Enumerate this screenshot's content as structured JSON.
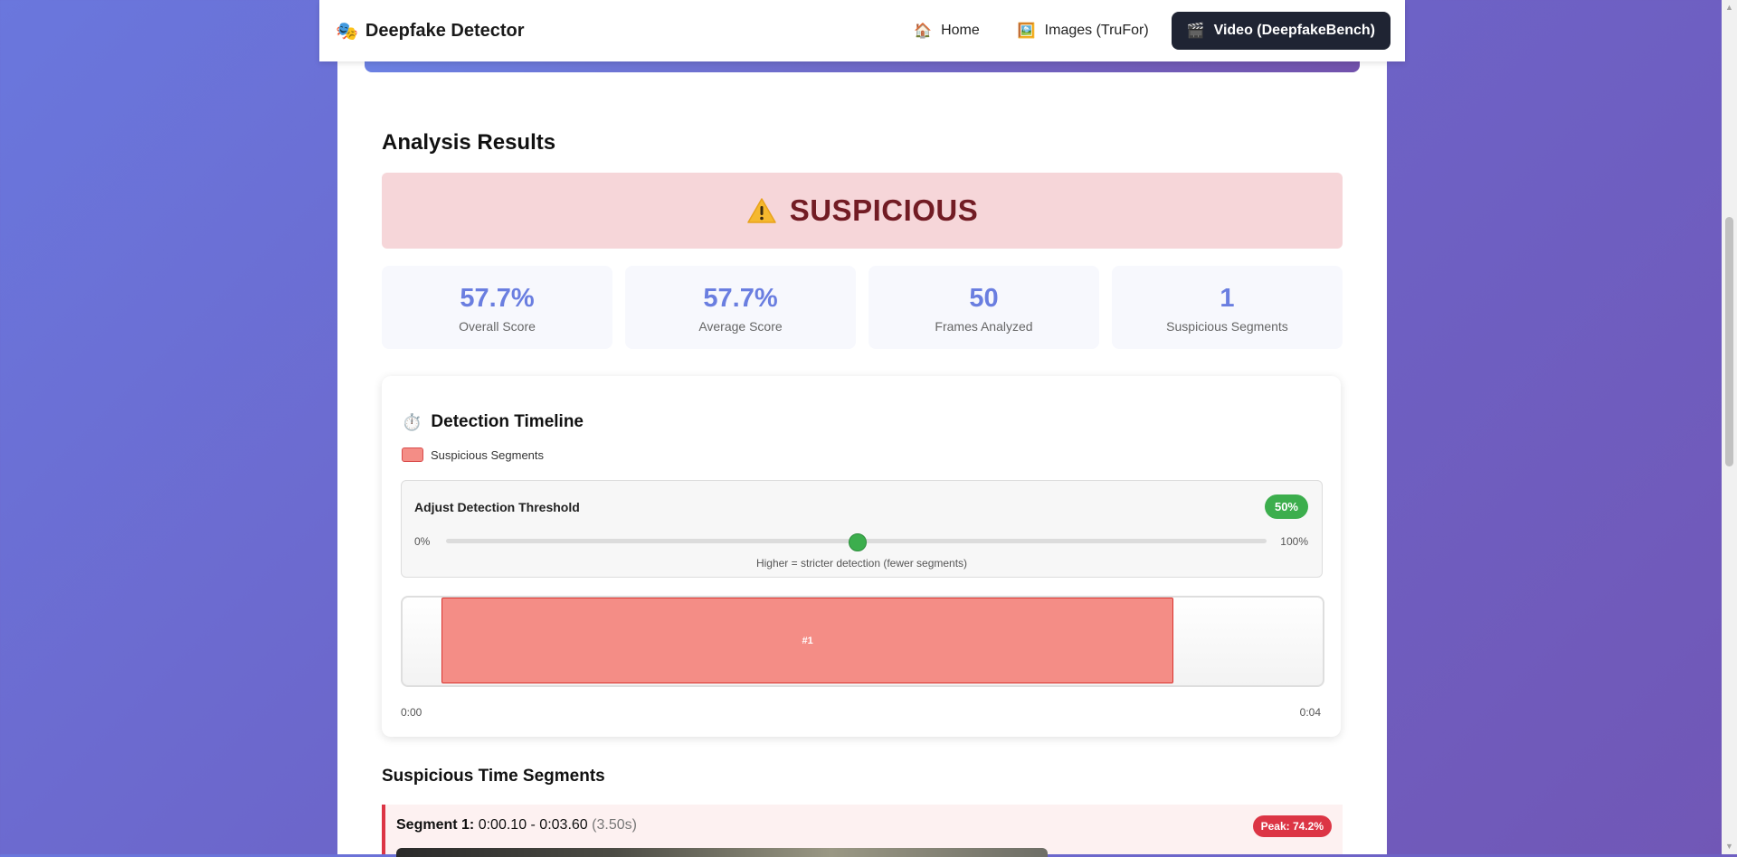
{
  "nav": {
    "brand": "Deepfake Detector",
    "brand_icon": "masks-icon",
    "links": [
      {
        "icon": "🏠",
        "label": "Home"
      },
      {
        "icon": "🖼️",
        "label": "Images (TruFor)"
      },
      {
        "icon": "🎬",
        "label": "Video (DeepfakeBench)"
      }
    ],
    "active_link": "Video (DeepfakeBench)"
  },
  "results": {
    "title": "Analysis Results",
    "verdict": "SUSPICIOUS",
    "verdict_icon": "warning-icon",
    "stats": [
      {
        "value": "57.7%",
        "label": "Overall Score"
      },
      {
        "value": "57.7%",
        "label": "Average Score"
      },
      {
        "value": "50",
        "label": "Frames Analyzed"
      },
      {
        "value": "1",
        "label": "Suspicious Segments"
      }
    ]
  },
  "timeline": {
    "title": "Detection Timeline",
    "icon": "⏱️",
    "legend": "Suspicious Segments",
    "threshold": {
      "label": "Adjust Detection Threshold",
      "value_label": "50%",
      "value": 0.5,
      "min_label": "0%",
      "max_label": "100%",
      "hint": "Higher = stricter detection (fewer segments)"
    },
    "duration_seconds": 4.3,
    "segments": [
      {
        "label": "#1",
        "start": 0.1,
        "end": 3.6
      }
    ],
    "start_label": "0:00",
    "end_label": "0:04"
  },
  "segments_section": {
    "title": "Suspicious Time Segments",
    "items": [
      {
        "name": "Segment 1:",
        "range": "0:00.10 - 0:03.60",
        "duration": "(3.50s)",
        "peak": "Peak: 74.2%"
      }
    ]
  },
  "colors": {
    "accent": "#6a7ee0",
    "danger": "#dc3545",
    "success": "#3cae4d",
    "verdict_bg": "#f6d6d9",
    "verdict_text": "#721c24"
  }
}
